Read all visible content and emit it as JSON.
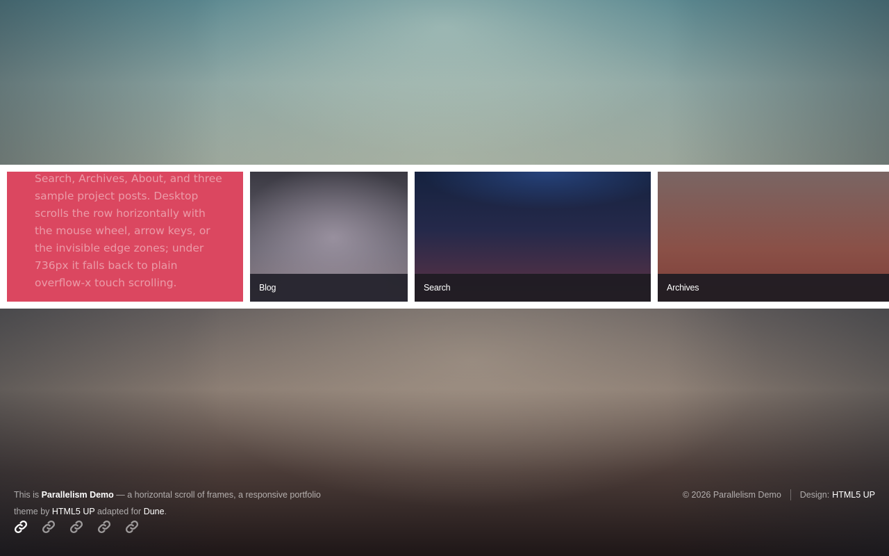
{
  "intro": {
    "text": "delays) that link out to Blog, Search, Archives, About, and three sample project posts. Desktop scrolls the row horizontally with the mouse wheel, arrow keys, or the invisible edge zones; under 736px it falls back to plain overflow-x touch scrolling."
  },
  "cards": [
    {
      "label": "Blog"
    },
    {
      "label": "Search"
    },
    {
      "label": "Archives"
    }
  ],
  "footer": {
    "prefix": "This is ",
    "site_name": "Parallelism Demo",
    "middle": " — a horizontal scroll of frames, a responsive portfolio theme by ",
    "theme_author": "HTML5 UP",
    "adapted": " adapted for ",
    "adapted_for": "Dune",
    "suffix": ".",
    "copyright": "© 2026 Parallelism Demo",
    "design_label": "Design:",
    "design_by": "HTML5 UP"
  },
  "social_icons": [
    {
      "icon": "link-icon"
    },
    {
      "icon": "link-icon"
    },
    {
      "icon": "link-icon"
    },
    {
      "icon": "link-icon"
    },
    {
      "icon": "link-icon"
    }
  ],
  "colors": {
    "intro_bg": "#db4760",
    "caption_bg": "#1d1b22",
    "strip_bg": "#ffffff"
  }
}
